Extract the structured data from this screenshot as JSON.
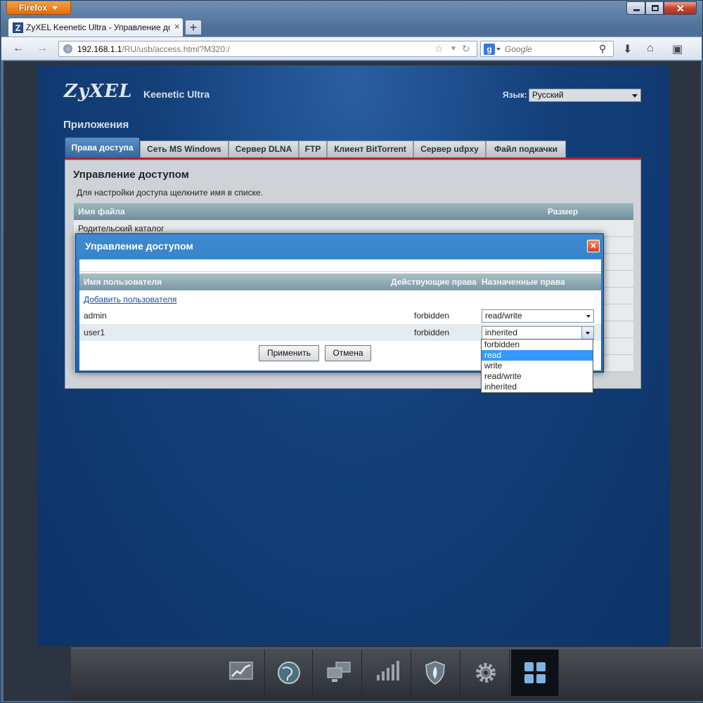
{
  "browser": {
    "menu_label": "Firefox",
    "tab_title": "ZyXEL Keenetic Ultra - Управление дост...",
    "tab_close": "×",
    "new_tab": "+",
    "url_host": "192.168.1.1",
    "url_path": "/RU/usb/access.html?M320:/",
    "search_placeholder": "Google",
    "window_close": "✕"
  },
  "header": {
    "logo": "ZyXEL",
    "model": "Keenetic Ultra",
    "lang_label": "Язык:",
    "lang_value": "Русский",
    "page_title": "Приложения"
  },
  "tabs": [
    {
      "label": "Права доступа"
    },
    {
      "label": "Сеть MS Windows"
    },
    {
      "label": "Сервер DLNA"
    },
    {
      "label": "FTP"
    },
    {
      "label": "Клиент BitTorrent"
    },
    {
      "label": "Сервер udpxy"
    },
    {
      "label": "Файл подкачки"
    }
  ],
  "panel": {
    "title": "Управление доступом",
    "description": "Для настройки доступа щелкните имя в списке.",
    "col_name": "Имя файла",
    "col_size": "Размер",
    "parent_dir": "Родительский каталог"
  },
  "dialog": {
    "title": "Управление доступом",
    "close": "×",
    "col_user": "Имя пользователя",
    "col_effective": "Действующие права",
    "col_assigned": "Назначенные права",
    "add_user": "Добавить пользователя",
    "rows": [
      {
        "user": "admin",
        "effective": "forbidden",
        "assigned": "read/write"
      },
      {
        "user": "user1",
        "effective": "forbidden",
        "assigned": "inherited"
      }
    ],
    "apply": "Применить",
    "cancel": "Отмена",
    "dropdown_options": [
      "forbidden",
      "read",
      "write",
      "read/write",
      "inherited"
    ],
    "dropdown_highlighted": "read"
  }
}
